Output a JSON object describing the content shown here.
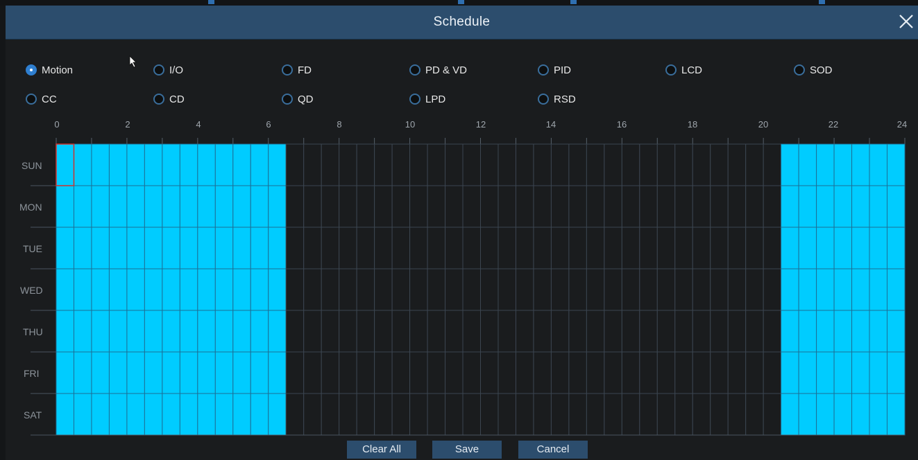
{
  "dialog": {
    "title": "Schedule"
  },
  "detection_types": [
    {
      "label": "Motion",
      "checked": true
    },
    {
      "label": "I/O",
      "checked": false
    },
    {
      "label": "FD",
      "checked": false
    },
    {
      "label": "PD & VD",
      "checked": false
    },
    {
      "label": "PID",
      "checked": false
    },
    {
      "label": "LCD",
      "checked": false
    },
    {
      "label": "SOD",
      "checked": false
    },
    {
      "label": "CC",
      "checked": false
    },
    {
      "label": "CD",
      "checked": false
    },
    {
      "label": "QD",
      "checked": false
    },
    {
      "label": "LPD",
      "checked": false
    },
    {
      "label": "RSD",
      "checked": false
    }
  ],
  "hour_labels": [
    "0",
    "2",
    "4",
    "6",
    "8",
    "10",
    "12",
    "14",
    "16",
    "18",
    "20",
    "22",
    "24"
  ],
  "days": [
    "SUN",
    "MON",
    "TUE",
    "WED",
    "THU",
    "FRI",
    "SAT"
  ],
  "schedule": {
    "slots_per_day": 48,
    "active_ranges_half_hour": [
      [
        0,
        13
      ],
      [
        41,
        48
      ]
    ],
    "selected_cell": {
      "day": "SUN",
      "slot": 0
    }
  },
  "colors": {
    "active": "#00ccff",
    "inactive": "#1a1c1e",
    "titlebar": "#2c4d6d",
    "selected_outline": "#d0312d"
  },
  "buttons": {
    "clear_all": "Clear All",
    "save": "Save",
    "cancel": "Cancel"
  }
}
